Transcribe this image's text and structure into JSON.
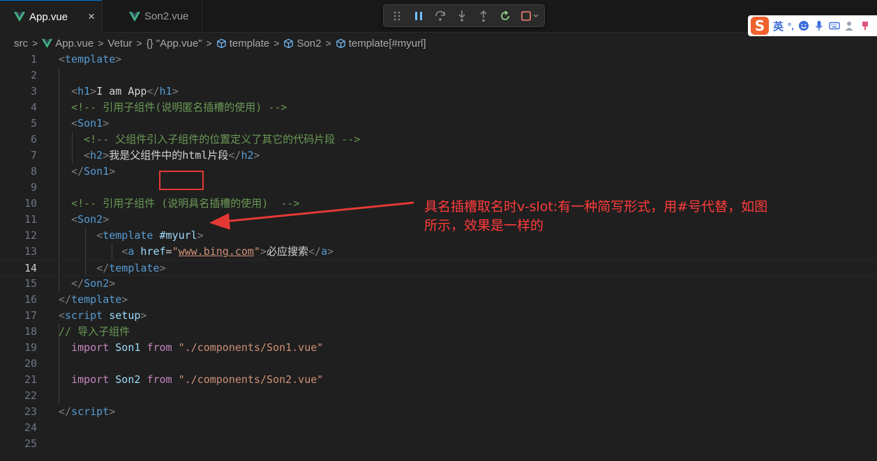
{
  "tabs": [
    {
      "label": "App.vue",
      "active": true,
      "close": "×"
    },
    {
      "label": "Son2.vue",
      "active": false
    }
  ],
  "ime": {
    "logo": "S",
    "lang": "英",
    "punct": "°,"
  },
  "breadcrumb": [
    "src",
    "App.vue",
    "Vetur",
    "{} \"App.vue\"",
    "template",
    "Son2",
    "template[#myurl]"
  ],
  "current_line": 14,
  "annotation": {
    "text": "具名插槽取名时v-slot:有一种简写形式，用#号代替，如图所示，效果是一样的",
    "color": "#ff3b3b"
  },
  "lines": [
    {
      "n": 1,
      "tokens": [
        [
          "br",
          "<"
        ],
        [
          "tag",
          "template"
        ],
        [
          "br",
          ">"
        ]
      ]
    },
    {
      "n": 2,
      "tokens": []
    },
    {
      "n": 3,
      "tokens": [
        [
          "txt",
          "  "
        ],
        [
          "br",
          "<"
        ],
        [
          "tag",
          "h1"
        ],
        [
          "br",
          ">"
        ],
        [
          "txt",
          "I am App"
        ],
        [
          "br",
          "</"
        ],
        [
          "tag",
          "h1"
        ],
        [
          "br",
          ">"
        ]
      ]
    },
    {
      "n": 4,
      "tokens": [
        [
          "txt",
          "  "
        ],
        [
          "cm",
          "<!-- 引用子组件(说明匿名插槽的使用) -->"
        ]
      ]
    },
    {
      "n": 5,
      "tokens": [
        [
          "txt",
          "  "
        ],
        [
          "br",
          "<"
        ],
        [
          "tag",
          "Son1"
        ],
        [
          "br",
          ">"
        ]
      ]
    },
    {
      "n": 6,
      "tokens": [
        [
          "txt",
          "    "
        ],
        [
          "cm",
          "<!-- 父组件引入子组件的位置定义了其它的代码片段 -->"
        ]
      ]
    },
    {
      "n": 7,
      "tokens": [
        [
          "txt",
          "    "
        ],
        [
          "br",
          "<"
        ],
        [
          "tag",
          "h2"
        ],
        [
          "br",
          ">"
        ],
        [
          "txt",
          "我是父组件中的html片段"
        ],
        [
          "br",
          "</"
        ],
        [
          "tag",
          "h2"
        ],
        [
          "br",
          ">"
        ]
      ]
    },
    {
      "n": 8,
      "tokens": [
        [
          "txt",
          "  "
        ],
        [
          "br",
          "</"
        ],
        [
          "tag",
          "Son1"
        ],
        [
          "br",
          ">"
        ]
      ]
    },
    {
      "n": 9,
      "tokens": []
    },
    {
      "n": 10,
      "tokens": [
        [
          "txt",
          "  "
        ],
        [
          "cm",
          "<!-- 引用子组件 (说明具名插槽的使用)  -->"
        ]
      ]
    },
    {
      "n": 11,
      "tokens": [
        [
          "txt",
          "  "
        ],
        [
          "br",
          "<"
        ],
        [
          "tag",
          "Son2"
        ],
        [
          "br",
          ">"
        ]
      ]
    },
    {
      "n": 12,
      "tokens": [
        [
          "txt",
          "      "
        ],
        [
          "br",
          "<"
        ],
        [
          "tag",
          "template"
        ],
        [
          "txt",
          " "
        ],
        [
          "slot",
          "#myurl"
        ],
        [
          "br",
          ">"
        ]
      ]
    },
    {
      "n": 13,
      "tokens": [
        [
          "txt",
          "          "
        ],
        [
          "br",
          "<"
        ],
        [
          "tag",
          "a"
        ],
        [
          "txt",
          " "
        ],
        [
          "attr",
          "href"
        ],
        [
          "txt",
          "="
        ],
        [
          "str",
          "\""
        ],
        [
          "strul",
          "www.bing.com"
        ],
        [
          "str",
          "\""
        ],
        [
          "br",
          ">"
        ],
        [
          "txt",
          "必应搜索"
        ],
        [
          "br",
          "</"
        ],
        [
          "tag",
          "a"
        ],
        [
          "br",
          ">"
        ]
      ]
    },
    {
      "n": 14,
      "tokens": [
        [
          "txt",
          "      "
        ],
        [
          "br",
          "</"
        ],
        [
          "tag",
          "template"
        ],
        [
          "br",
          ">"
        ]
      ]
    },
    {
      "n": 15,
      "tokens": [
        [
          "txt",
          "  "
        ],
        [
          "br",
          "</"
        ],
        [
          "tag",
          "Son2"
        ],
        [
          "br",
          ">"
        ]
      ]
    },
    {
      "n": 16,
      "tokens": [
        [
          "br",
          "</"
        ],
        [
          "tag",
          "template"
        ],
        [
          "br",
          ">"
        ]
      ]
    },
    {
      "n": 17,
      "tokens": [
        [
          "br",
          "<"
        ],
        [
          "tag",
          "script"
        ],
        [
          "txt",
          " "
        ],
        [
          "attr",
          "setup"
        ],
        [
          "br",
          ">"
        ]
      ]
    },
    {
      "n": 18,
      "tokens": [
        [
          "cm",
          "// 导入子组件"
        ]
      ]
    },
    {
      "n": 19,
      "tokens": [
        [
          "txt",
          "  "
        ],
        [
          "kw",
          "import"
        ],
        [
          "txt",
          " "
        ],
        [
          "var",
          "Son1"
        ],
        [
          "txt",
          " "
        ],
        [
          "kw",
          "from"
        ],
        [
          "txt",
          " "
        ],
        [
          "str",
          "\"./components/Son1.vue\""
        ]
      ]
    },
    {
      "n": 20,
      "tokens": []
    },
    {
      "n": 21,
      "tokens": [
        [
          "txt",
          "  "
        ],
        [
          "kw",
          "import"
        ],
        [
          "txt",
          " "
        ],
        [
          "var",
          "Son2"
        ],
        [
          "txt",
          " "
        ],
        [
          "kw",
          "from"
        ],
        [
          "txt",
          " "
        ],
        [
          "str",
          "\"./components/Son2.vue\""
        ]
      ]
    },
    {
      "n": 22,
      "tokens": []
    },
    {
      "n": 23,
      "tokens": [
        [
          "br",
          "</"
        ],
        [
          "tag",
          "script"
        ],
        [
          "br",
          ">"
        ]
      ]
    },
    {
      "n": 24,
      "tokens": []
    },
    {
      "n": 25,
      "tokens": []
    }
  ],
  "colors": {
    "comment": "#6a9955",
    "tag": "#569cd6",
    "string": "#ce9178",
    "keyword": "#c586c0",
    "annotation": "#ff3b3b"
  }
}
